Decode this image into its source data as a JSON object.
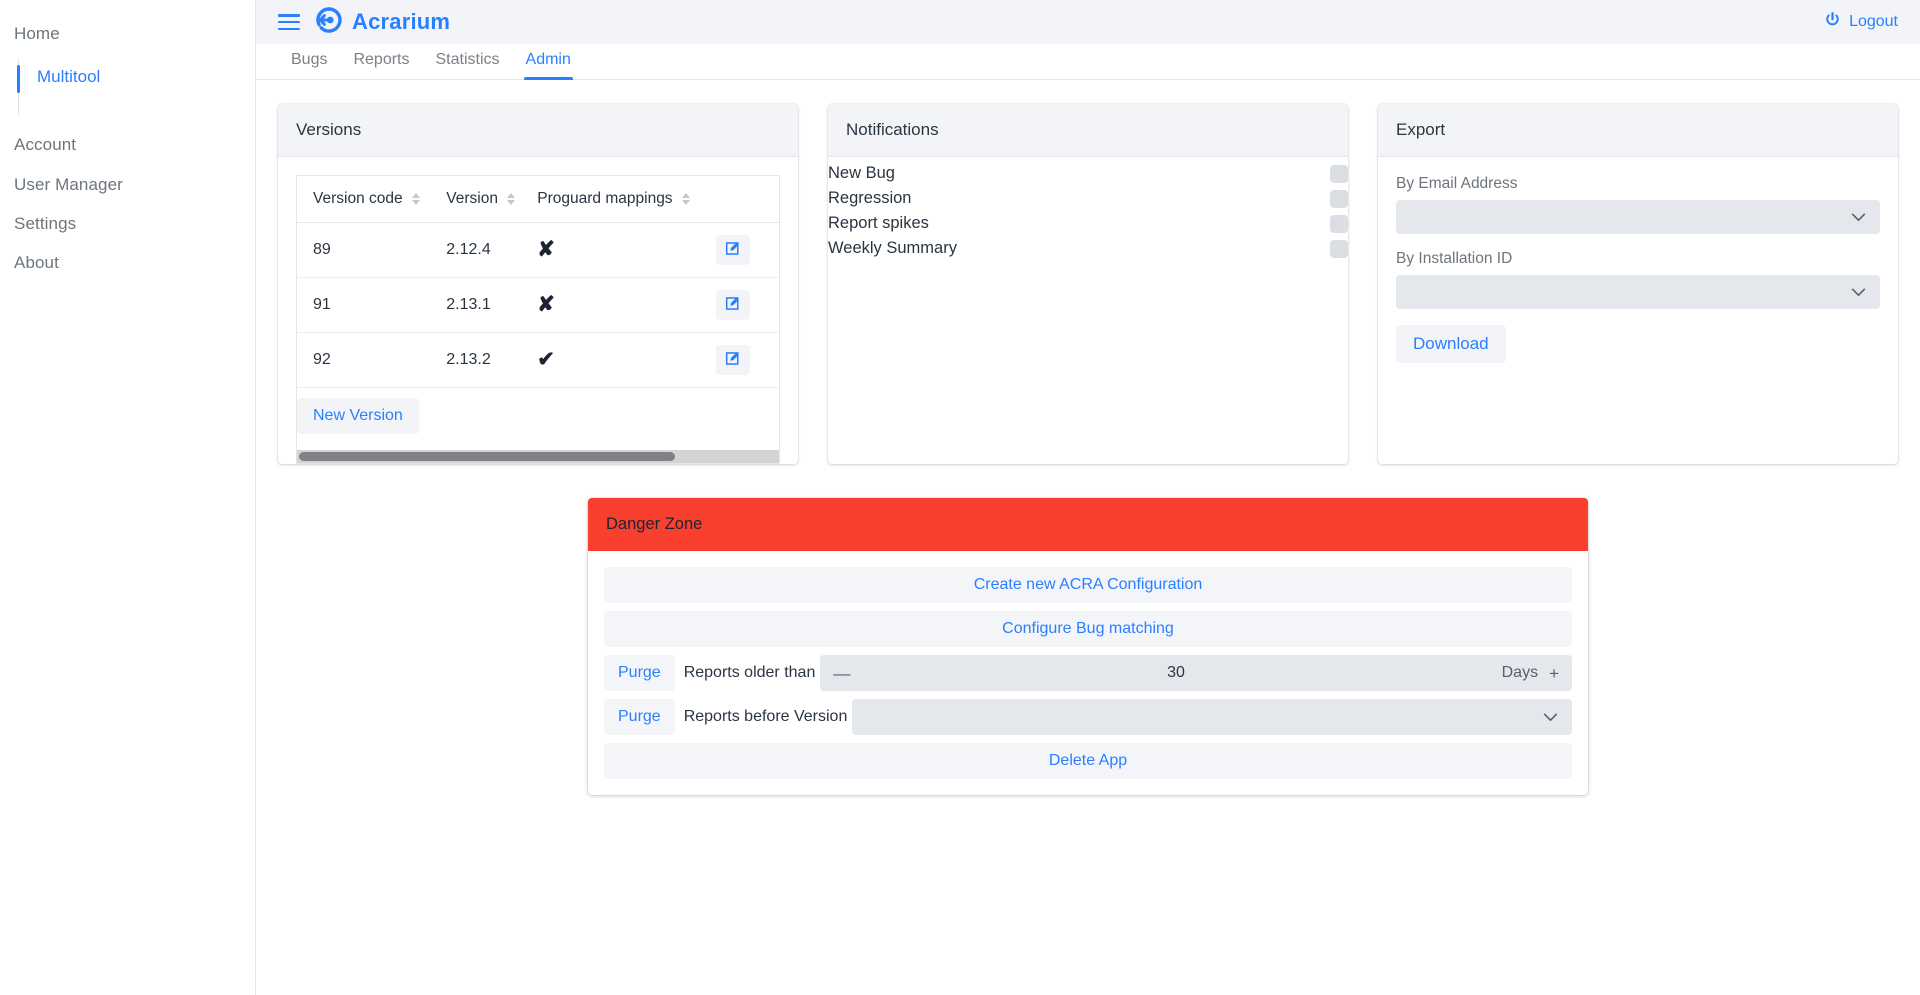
{
  "sidebar": {
    "items": [
      {
        "label": "Home"
      },
      {
        "label": "Account"
      },
      {
        "label": "User Manager"
      },
      {
        "label": "Settings"
      },
      {
        "label": "About"
      }
    ],
    "active_sub": "Multitool"
  },
  "topbar": {
    "menu_icon": "hamburger-icon",
    "logo_icon": "acrarium-logo-icon",
    "brand": "Acrarium",
    "logout_icon": "power-icon",
    "logout_label": "Logout"
  },
  "tabs": [
    {
      "label": "Bugs",
      "active": false
    },
    {
      "label": "Reports",
      "active": false
    },
    {
      "label": "Statistics",
      "active": false
    },
    {
      "label": "Admin",
      "active": true
    }
  ],
  "versions": {
    "title": "Versions",
    "columns": [
      "Version code",
      "Version",
      "Proguard mappings"
    ],
    "sort_icon": "sort-updown-icon",
    "edit_icon": "edit-pencil-icon",
    "rows": [
      {
        "code": "89",
        "version": "2.12.4",
        "proguard": "✘"
      },
      {
        "code": "91",
        "version": "2.13.1",
        "proguard": "✘"
      },
      {
        "code": "92",
        "version": "2.13.2",
        "proguard": "✔"
      }
    ],
    "new_version_label": "New Version",
    "scrollbar_thumb_pct": 78
  },
  "notifications": {
    "title": "Notifications",
    "items": [
      {
        "label": "New Bug",
        "checked": false
      },
      {
        "label": "Regression",
        "checked": false
      },
      {
        "label": "Report spikes",
        "checked": false
      },
      {
        "label": "Weekly Summary",
        "checked": false
      }
    ]
  },
  "export": {
    "title": "Export",
    "email_label": "By Email Address",
    "email_value": "",
    "installation_label": "By Installation ID",
    "installation_value": "",
    "chevron_icon": "chevron-down-icon",
    "download_label": "Download"
  },
  "danger_zone": {
    "title": "Danger Zone",
    "header_color": "#f9402e",
    "create_acra_label": "Create new ACRA Configuration",
    "configure_bug_label": "Configure Bug matching",
    "purge_label": "Purge",
    "reports_older_label": "Reports older than",
    "minus_glyph": "—",
    "days_value": "30",
    "days_unit": "Days",
    "plus_glyph": "+",
    "reports_before_label": "Reports before Version",
    "version_select_value": "",
    "delete_app_label": "Delete App"
  },
  "colors": {
    "accent": "#2a7fff",
    "danger": "#f9402e",
    "text": "#2a3542",
    "muted": "#6c757d",
    "panel": "#f2f4f7",
    "input": "#e4e7ec"
  }
}
